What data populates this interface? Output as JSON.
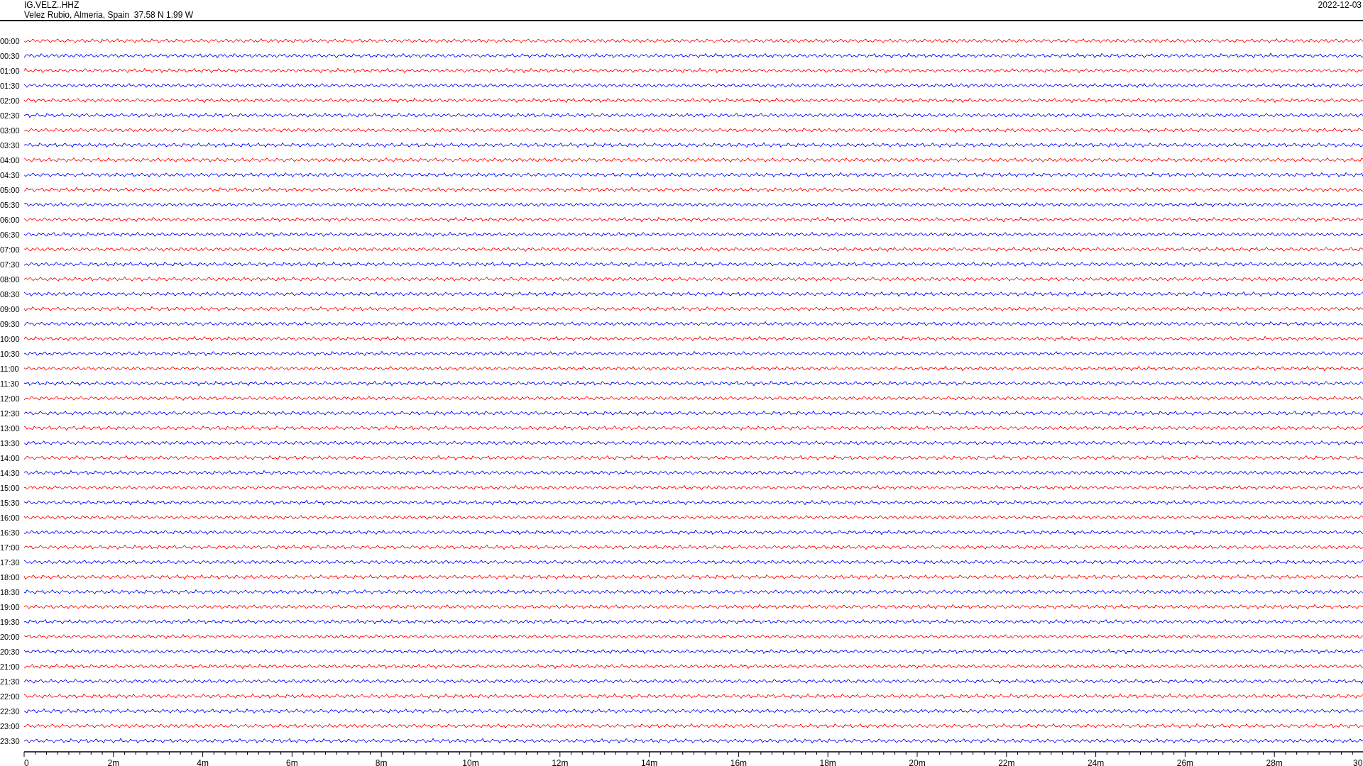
{
  "header": {
    "station": "IG.VELZ..HHZ",
    "location": "Velez Rubio, Almeria, Spain  37.58 N 1.99 W",
    "date": "2022-12-03"
  },
  "traces": [
    {
      "time": "00:00",
      "color": "#ff0000"
    },
    {
      "time": "00:30",
      "color": "#0000ff"
    },
    {
      "time": "01:00",
      "color": "#ff0000"
    },
    {
      "time": "01:30",
      "color": "#0000ff"
    },
    {
      "time": "02:00",
      "color": "#ff0000"
    },
    {
      "time": "02:30",
      "color": "#0000ff"
    },
    {
      "time": "03:00",
      "color": "#ff0000"
    },
    {
      "time": "03:30",
      "color": "#0000ff"
    },
    {
      "time": "04:00",
      "color": "#ff0000"
    },
    {
      "time": "04:30",
      "color": "#0000ff"
    },
    {
      "time": "05:00",
      "color": "#ff0000"
    },
    {
      "time": "05:30",
      "color": "#0000ff"
    },
    {
      "time": "06:00",
      "color": "#ff0000"
    },
    {
      "time": "06:30",
      "color": "#0000ff"
    },
    {
      "time": "07:00",
      "color": "#ff0000"
    },
    {
      "time": "07:30",
      "color": "#0000ff"
    },
    {
      "time": "08:00",
      "color": "#ff0000"
    },
    {
      "time": "08:30",
      "color": "#0000ff"
    },
    {
      "time": "09:00",
      "color": "#ff0000"
    },
    {
      "time": "09:30",
      "color": "#0000ff"
    },
    {
      "time": "10:00",
      "color": "#ff0000"
    },
    {
      "time": "10:30",
      "color": "#0000ff"
    },
    {
      "time": "11:00",
      "color": "#ff0000"
    },
    {
      "time": "11:30",
      "color": "#0000ff"
    },
    {
      "time": "12:00",
      "color": "#ff0000"
    },
    {
      "time": "12:30",
      "color": "#0000ff"
    },
    {
      "time": "13:00",
      "color": "#ff0000"
    },
    {
      "time": "13:30",
      "color": "#0000ff"
    },
    {
      "time": "14:00",
      "color": "#ff0000"
    },
    {
      "time": "14:30",
      "color": "#0000ff"
    },
    {
      "time": "15:00",
      "color": "#ff0000"
    },
    {
      "time": "15:30",
      "color": "#0000ff"
    },
    {
      "time": "16:00",
      "color": "#ff0000"
    },
    {
      "time": "16:30",
      "color": "#0000ff"
    },
    {
      "time": "17:00",
      "color": "#ff0000"
    },
    {
      "time": "17:30",
      "color": "#0000ff"
    },
    {
      "time": "18:00",
      "color": "#ff0000"
    },
    {
      "time": "18:30",
      "color": "#0000ff"
    },
    {
      "time": "19:00",
      "color": "#ff0000"
    },
    {
      "time": "19:30",
      "color": "#0000ff"
    },
    {
      "time": "20:00",
      "color": "#ff0000"
    },
    {
      "time": "20:30",
      "color": "#0000ff"
    },
    {
      "time": "21:00",
      "color": "#ff0000"
    },
    {
      "time": "21:30",
      "color": "#0000ff"
    },
    {
      "time": "22:00",
      "color": "#ff0000"
    },
    {
      "time": "22:30",
      "color": "#0000ff"
    },
    {
      "time": "23:00",
      "color": "#ff0000"
    },
    {
      "time": "23:30",
      "color": "#0000ff"
    }
  ],
  "x_axis": {
    "labels": [
      "0",
      "2m",
      "4m",
      "6m",
      "8m",
      "10m",
      "12m",
      "14m",
      "16m",
      "18m",
      "20m",
      "22m",
      "24m",
      "26m",
      "28m",
      "30"
    ]
  }
}
